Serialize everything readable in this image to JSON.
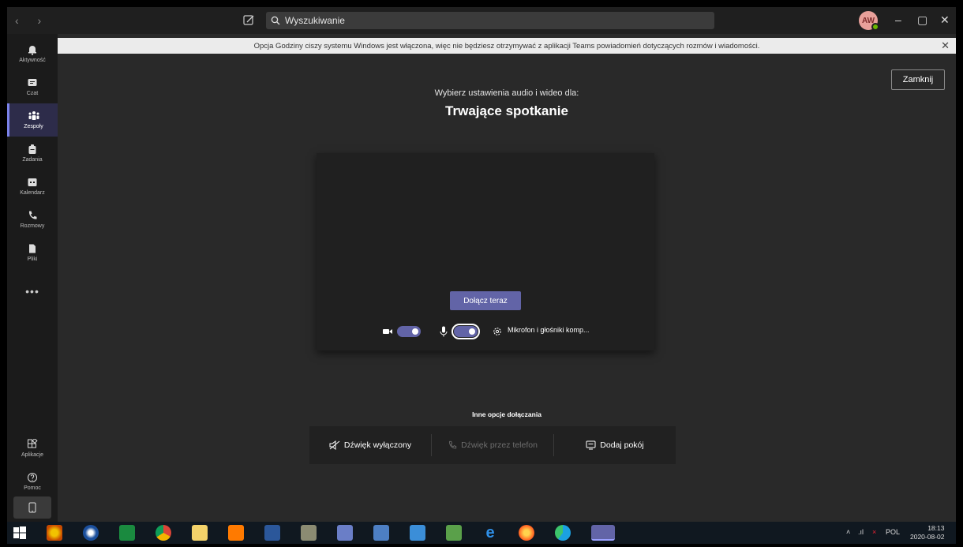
{
  "titlebar": {
    "nav": "‹ ›",
    "search_placeholder": "Wyszukiwanie",
    "avatar_initials": "AW",
    "minimize": "–",
    "maximize": "▢",
    "close": "✕"
  },
  "banner": {
    "text": "Opcja Godziny ciszy systemu Windows jest włączona, więc nie będziesz otrzymywać z aplikacji Teams powiadomień dotyczących rozmów i wiadomości.",
    "close": "✕"
  },
  "rail": {
    "items": [
      {
        "label": "Aktywność",
        "icon": "bell-icon"
      },
      {
        "label": "Czat",
        "icon": "chat-icon"
      },
      {
        "label": "Zespoły",
        "icon": "teams-icon"
      },
      {
        "label": "Zadania",
        "icon": "assignments-icon"
      },
      {
        "label": "Kalendarz",
        "icon": "calendar-icon"
      },
      {
        "label": "Rozmowy",
        "icon": "phone-icon"
      },
      {
        "label": "Pliki",
        "icon": "files-icon"
      }
    ],
    "more": "•••",
    "apps_label": "Aplikacje",
    "help_label": "Pomoc",
    "active": "Zespoły"
  },
  "main": {
    "close_button": "Zamknij",
    "subtitle": "Wybierz ustawienia audio i wideo dla:",
    "title": "Trwające spotkanie",
    "join_button": "Dołącz teraz",
    "camera_on": true,
    "mic_on": true,
    "device_label": "Mikrofon i głośniki komp...",
    "other_title": "Inne opcje dołączania",
    "options": [
      {
        "label": "Dźwięk wyłączony",
        "disabled": false
      },
      {
        "label": "Dźwięk przez telefon",
        "disabled": true
      },
      {
        "label": "Dodaj pokój",
        "disabled": false
      }
    ]
  },
  "taskbar": {
    "tray_lang": "POL",
    "time": "18:13",
    "date": "2020-08-02"
  },
  "colors": {
    "accent": "#6264a7",
    "rail_bg": "#1b1b1b",
    "main_bg": "#292929"
  }
}
